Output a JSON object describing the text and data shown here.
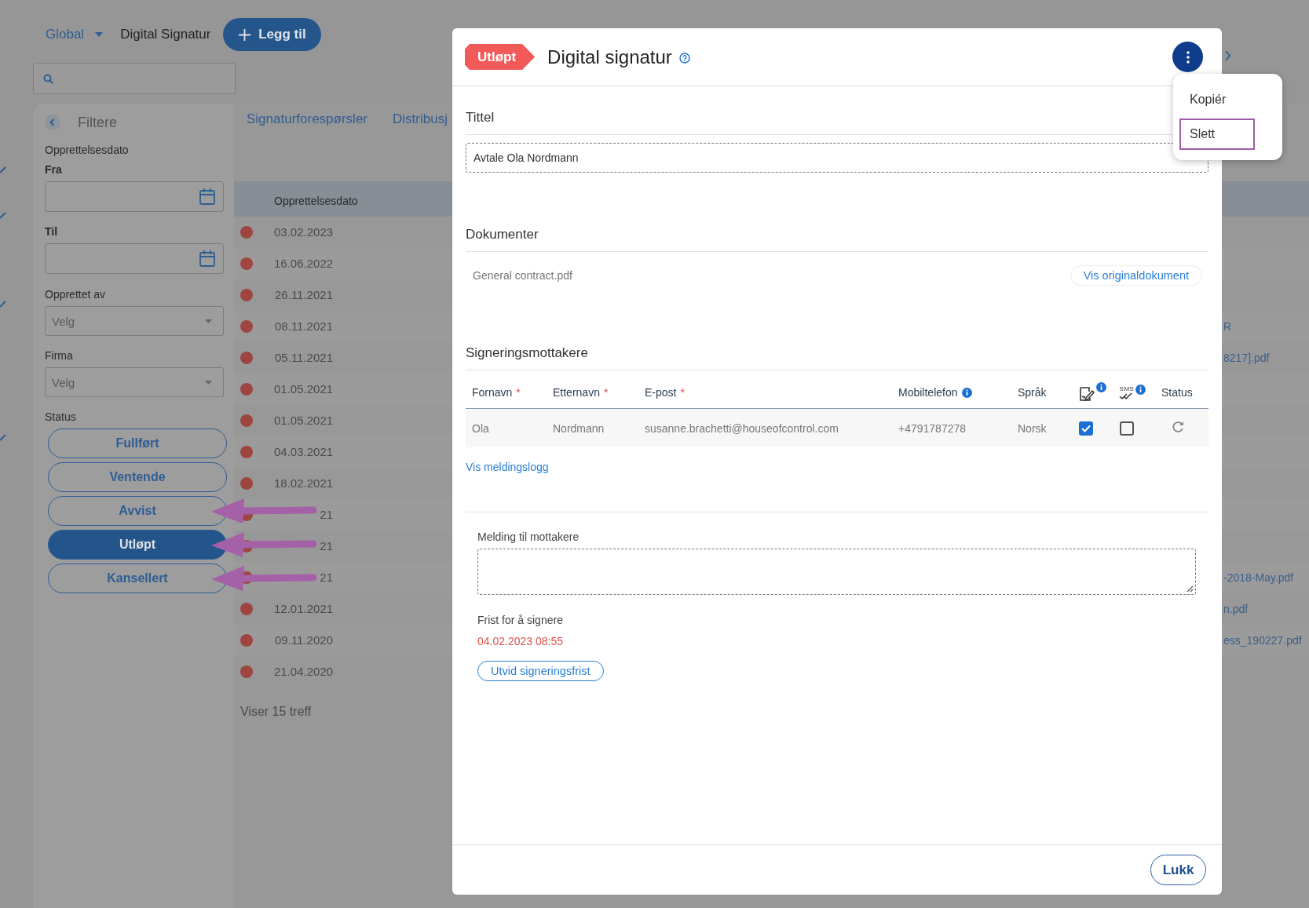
{
  "header": {
    "scope": "Global",
    "title": "Digital Signatur",
    "add_button": "Legg til"
  },
  "filters": {
    "title": "Filtere",
    "date_label": "Opprettelsesdato",
    "from_label": "Fra",
    "to_label": "Til",
    "created_by": {
      "label": "Opprettet av",
      "placeholder": "Velg"
    },
    "company": {
      "label": "Firma",
      "placeholder": "Velg"
    },
    "status_label": "Status",
    "statuses": [
      {
        "label": "Fullført",
        "selected": false,
        "marked": false
      },
      {
        "label": "Ventende",
        "selected": false,
        "marked": false
      },
      {
        "label": "Avvist",
        "selected": false,
        "marked": true
      },
      {
        "label": "Utløpt",
        "selected": true,
        "marked": true
      },
      {
        "label": "Kansellert",
        "selected": false,
        "marked": true
      }
    ]
  },
  "tabs": [
    {
      "label": "Signaturforespørsler"
    },
    {
      "label": "Distribusj"
    }
  ],
  "list": {
    "column": "Opprettelsesdato",
    "count": "Viser 15 treff",
    "rows": [
      {
        "date": "03.02.2023"
      },
      {
        "date": "16.06.2022"
      },
      {
        "date": "26.11.2021"
      },
      {
        "date": "08.11.2021",
        "column_2": "R"
      },
      {
        "date": "05.11.2021",
        "column_2": "8217].pdf"
      },
      {
        "date": "01.05.2021"
      },
      {
        "date": "01.05.2021"
      },
      {
        "date": "04.03.2021"
      },
      {
        "date": "18.02.2021"
      },
      {
        "date": "21"
      },
      {
        "date": "21"
      },
      {
        "date": "21",
        "column_2": "-2018-May.pdf"
      },
      {
        "date": "12.01.2021",
        "column_2": "n.pdf"
      },
      {
        "date": "09.11.2020",
        "column_2": "ess_190227.pdf"
      },
      {
        "date": "21.04.2020"
      }
    ]
  },
  "dialog": {
    "status_badge": "Utløpt",
    "title": "Digital signatur",
    "menu": [
      {
        "label": "Kopiér",
        "highlighted": false
      },
      {
        "label": "Slett",
        "highlighted": true
      }
    ],
    "title_section": {
      "heading": "Tittel",
      "value": "Avtale Ola Nordmann"
    },
    "documents": {
      "heading": "Dokumenter",
      "items": [
        {
          "name": "General contract.pdf",
          "action": "Vis originaldokument"
        }
      ]
    },
    "recipients": {
      "heading": "Signeringsmottakere",
      "columns": [
        {
          "kind": "text",
          "label": "Fornavn",
          "required_mark": "*",
          "info": false
        },
        {
          "kind": "text",
          "label": "Etternavn",
          "required_mark": "*",
          "info": false
        },
        {
          "kind": "text",
          "label": "E-post",
          "required_mark": "*",
          "info": false
        },
        {
          "kind": "text",
          "label": "Mobiltelefon",
          "info": true
        },
        {
          "kind": "text",
          "label": "Språk",
          "info": false
        },
        {
          "kind": "sign",
          "info": true
        },
        {
          "kind": "sms",
          "label": "SMS",
          "info": true
        },
        {
          "kind": "text",
          "label": "Status",
          "info": false
        }
      ],
      "rows": [
        {
          "cells": [
            "Ola",
            "Nordmann",
            "susanne.brachetti@houseofcontrol.com",
            "+4791787278",
            "Norsk"
          ],
          "signature": true,
          "sms": false
        }
      ],
      "log_link": "Vis meldingslogg"
    },
    "message": {
      "label": "Melding til mottakere"
    },
    "deadline": {
      "label": "Frist for å signere",
      "value": "04.02.2023 08:55",
      "expired": true,
      "action": "Utvid signeringsfrist"
    },
    "close_button": "Lukk"
  }
}
